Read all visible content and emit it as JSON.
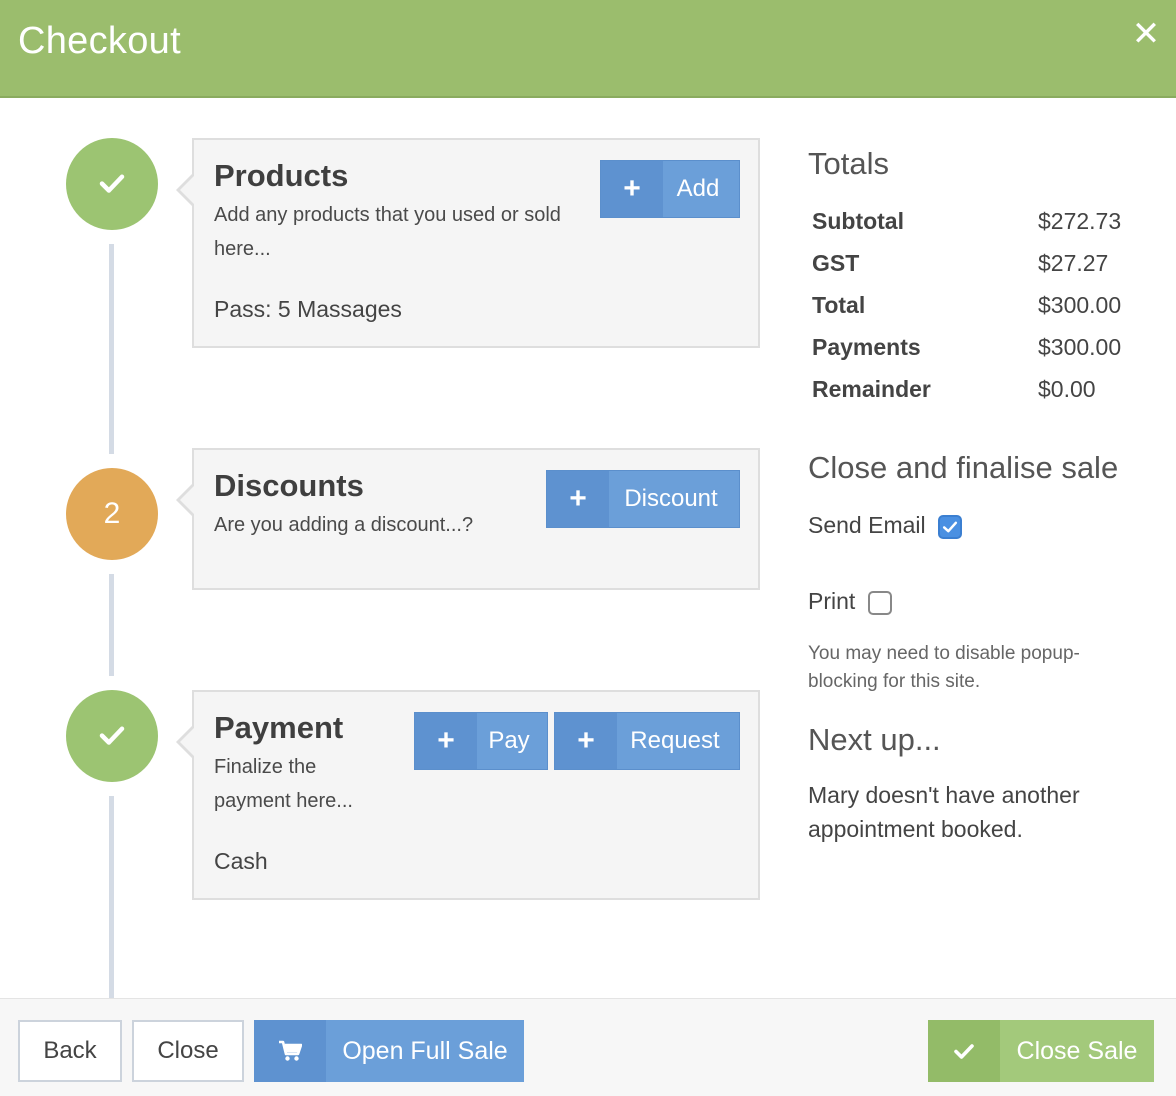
{
  "header": {
    "title": "Checkout"
  },
  "steps": {
    "products": {
      "badge": "",
      "title": "Products",
      "desc_line1": "Add any products that you used or sold",
      "desc_line2": "here...",
      "value": "Pass: 5 Massages",
      "button_label": "Add"
    },
    "discounts": {
      "badge": "2",
      "title": "Discounts",
      "desc_line1": "Are you adding a discount...?",
      "button_label": "Discount"
    },
    "payment": {
      "badge": "",
      "title": "Payment",
      "desc_line1": "Finalize the",
      "desc_line2": "payment here...",
      "value": "Cash",
      "pay_label": "Pay",
      "request_label": "Request"
    }
  },
  "totals": {
    "heading": "Totals",
    "rows": [
      {
        "label": "Subtotal",
        "value": "$272.73"
      },
      {
        "label": "GST",
        "value": "$27.27"
      },
      {
        "label": "Total",
        "value": "$300.00"
      },
      {
        "label": "Payments",
        "value": "$300.00"
      },
      {
        "label": "Remainder",
        "value": "$0.00"
      }
    ]
  },
  "finalise": {
    "heading": "Close and finalise sale",
    "send_email_label": "Send Email",
    "send_email_checked": true,
    "print_label": "Print",
    "print_checked": false,
    "popup_note_line1": "You may need to disable popup-",
    "popup_note_line2": "blocking for this site."
  },
  "next_up": {
    "heading": "Next up...",
    "line1": "Mary doesn't have another",
    "line2": "appointment booked."
  },
  "footer": {
    "back_label": "Back",
    "close_label": "Close",
    "open_full_sale_label": "Open Full Sale",
    "close_sale_label": "Close Sale"
  },
  "colors": {
    "header_green": "#9bbd6d",
    "step_done": "#9cc472",
    "step_pending": "#e2a958",
    "button_blue": "#6b9fd9"
  },
  "icons": [
    "close-icon",
    "check-icon",
    "plus-icon",
    "cart-icon"
  ]
}
